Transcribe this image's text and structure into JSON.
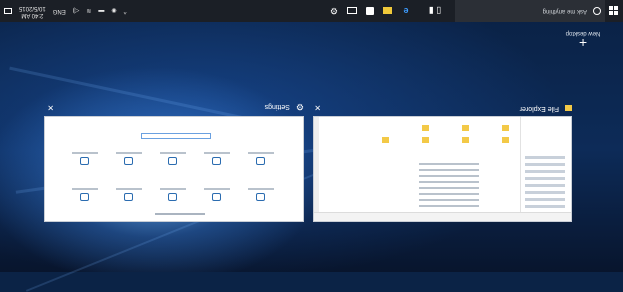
{
  "taskbar": {
    "search_placeholder": "Ask me anything",
    "clock_time": "2:40 AM",
    "clock_date": "10/5/2015",
    "pinned_icons": [
      "file-explorer-icon",
      "edge-icon",
      "folder-icon",
      "store-icon",
      "mail-icon",
      "settings-icon"
    ]
  },
  "task_view": {
    "new_desktop_label": "New desktop",
    "windows": [
      {
        "title": "File Explorer",
        "icon": "folder-icon"
      },
      {
        "title": "Settings",
        "icon": "gear-icon"
      }
    ]
  },
  "colors": {
    "taskbar_bg": "#1b1f26",
    "accent": "#3d9cff",
    "desktop_bg": "#0d2b58"
  }
}
